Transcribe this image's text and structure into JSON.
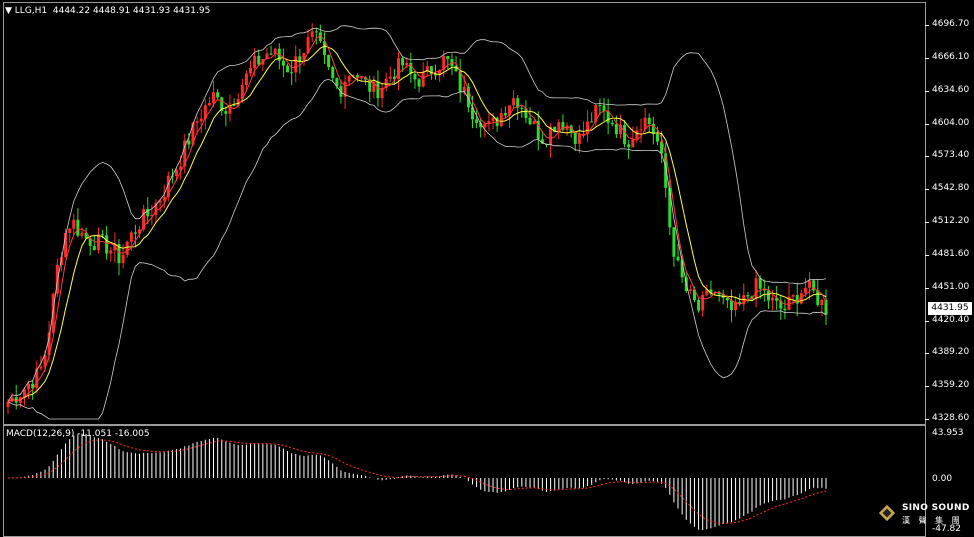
{
  "symbol_header": "LLG,H1  4444.22 4448.91 4431.93 4431.95",
  "macd_header": "MACD(12,26,9) -11.051 -16.005",
  "current_price": "4431.95",
  "price_axis": [
    "4696.70",
    "4666.10",
    "4634.60",
    "4604.00",
    "4573.40",
    "4542.80",
    "4512.20",
    "4481.60",
    "4451.00",
    "4420.40",
    "4389.20",
    "4359.20",
    "4328.60"
  ],
  "macd_axis": {
    "top": "43.953",
    "zero": "0.00",
    "bottom": "-47.82"
  },
  "logo": {
    "name": "SINO SOUND",
    "sub": "漢 聲 集 團"
  },
  "colors": {
    "up": "#ff2a2a",
    "down": "#2bdc2b",
    "ma_fast": "#ff3a3a",
    "ma_slow": "#ffff40",
    "band": "#cfcfcf",
    "macd_hist": "#ffffff",
    "macd_signal": "#ff3030"
  },
  "chart_data": {
    "type": "candlestick",
    "timeframe": "H1",
    "ylim": [
      4328.6,
      4710
    ],
    "close_path": [
      4345,
      4350,
      4355,
      4362,
      4368,
      4380,
      4420,
      4470,
      4500,
      4515,
      4505,
      4498,
      4495,
      4493,
      4490,
      4485,
      4478,
      4495,
      4505,
      4515,
      4520,
      4530,
      4540,
      4555,
      4565,
      4580,
      4595,
      4610,
      4620,
      4630,
      4625,
      4618,
      4628,
      4640,
      4650,
      4660,
      4665,
      4672,
      4668,
      4660,
      4655,
      4665,
      4675,
      4685,
      4680,
      4660,
      4645,
      4635,
      4650,
      4655,
      4645,
      4640,
      4635,
      4640,
      4648,
      4655,
      4660,
      4650,
      4645,
      4648,
      4655,
      4660,
      4665,
      4655,
      4640,
      4630,
      4615,
      4610,
      4600,
      4605,
      4615,
      4625,
      4630,
      4620,
      4608,
      4598,
      4590,
      4600,
      4608,
      4605,
      4598,
      4590,
      4600,
      4612,
      4618,
      4610,
      4605,
      4595,
      4590,
      4600,
      4610,
      4605,
      4590,
      4560,
      4500,
      4470,
      4450,
      4440,
      4430,
      4442,
      4450,
      4440,
      4432,
      4428,
      4435,
      4445,
      4452,
      4448,
      4440,
      4434,
      4430,
      4438,
      4445,
      4452,
      4448,
      4440,
      4432
    ]
  }
}
